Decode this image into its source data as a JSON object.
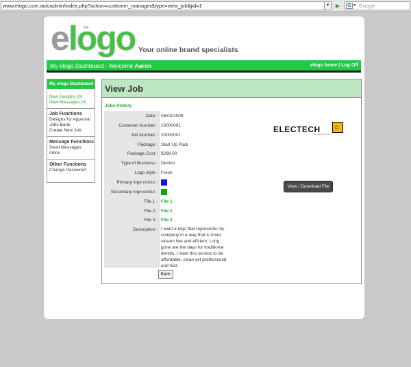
{
  "browser": {
    "url": "www.elogo.com.au/cadmin/index.php?action=customer_manager&type=view_job&jid=1",
    "search_placeholder": "Google",
    "search_engine": "G"
  },
  "header": {
    "logo_e": "e",
    "logo_rest": "logo",
    "logo_tm": "TM",
    "tagline": "Your online brand specialists"
  },
  "nav": {
    "welcome_prefix": "My elogo Dashboard - Welcome",
    "user": "Aaron",
    "links": "elogo home | Log Off"
  },
  "sidebar": {
    "title": "My elogo Dashboard",
    "new_designs": "New Designs (0)",
    "new_messages": "New Messages (0)",
    "job_functions": {
      "title": "Job Functions",
      "items": [
        "Designs for Approval",
        "Jobs Bank",
        "Create New Job"
      ]
    },
    "message_functions": {
      "title": "Message Functions",
      "items": [
        "Send Messages",
        "Inbox"
      ]
    },
    "other_functions": {
      "title": "Other Functions",
      "items": [
        "Change Password"
      ]
    }
  },
  "main": {
    "title": "View Job",
    "section": "Jobs History",
    "labels": {
      "date": "Date :",
      "customer_number": "Customer Number :",
      "job_number": "Job Number :",
      "package": "Package :",
      "package_cost": "Package Cost :",
      "business_type": "Type of Business :",
      "logo_style": "Logo style :",
      "primary_colour": "Primary logo colour :",
      "secondary_colour": "Secondary logo colour :",
      "file1": "File 1 :",
      "file2": "File 2 :",
      "file3": "File 3 :",
      "description": "Description :"
    },
    "values": {
      "date": "06/03/2008",
      "customer_number": "10000001",
      "job_number": "20000001",
      "package": "Start Up Pack",
      "package_cost": "$299.00",
      "business_type": "Dentist",
      "logo_style": "Fresh",
      "file1": "File 1",
      "file2": "File 2",
      "file3": "File 3",
      "description": "I want a logo that represents my company in a way that is more stream line and effcient. Long gone are the days for traditional dentits, I want this service to be affordable, clean yet professional and fast."
    },
    "colours": {
      "primary": "#1414e6",
      "secondary": "#11a411"
    },
    "back_label": "Back",
    "brand_word": "ELECTECH",
    "brand_sub": "ELECTRICAL",
    "download_label": "View / Download File"
  }
}
